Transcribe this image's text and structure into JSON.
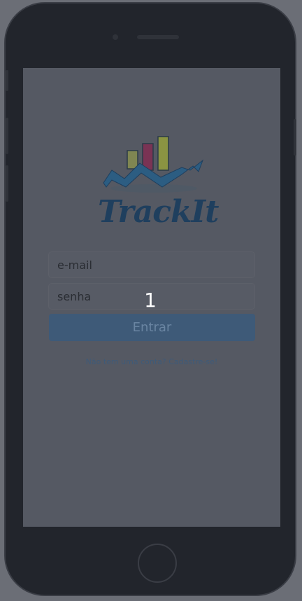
{
  "app": {
    "logo_text": "TrackIt"
  },
  "form": {
    "email_placeholder": "e-mail",
    "password_placeholder": "senha",
    "submit_label": "Entrar",
    "signup_link": "Não tem uma conta? Cadastre-se!"
  },
  "overlay": {
    "step_number": "1"
  },
  "colors": {
    "brand_dark_blue": "#1f3f5e",
    "button_blue": "#3e5a78",
    "bar_green": "#c9d45a",
    "bar_magenta": "#b9326e",
    "arrow_blue": "#2f6f9f"
  },
  "icons": {
    "logo_chart": "bar-chart-with-rising-arrow"
  }
}
